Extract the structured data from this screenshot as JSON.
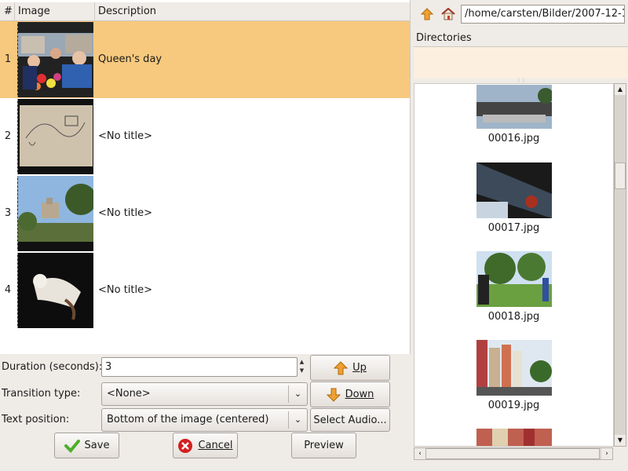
{
  "table": {
    "headers": {
      "num": "#",
      "image": "Image",
      "description": "Description"
    },
    "rows": [
      {
        "num": "1",
        "description": "Queen's day",
        "selected": true
      },
      {
        "num": "2",
        "description": "<No title>",
        "selected": false
      },
      {
        "num": "3",
        "description": "<No title>",
        "selected": false
      },
      {
        "num": "4",
        "description": "<No title>",
        "selected": false
      }
    ]
  },
  "form": {
    "duration_label": "Duration (seconds):",
    "duration_value": "3",
    "transition_label": "Transition type:",
    "transition_value": "<None>",
    "textpos_label": "Text position:",
    "textpos_value": "Bottom of the image (centered)"
  },
  "buttons": {
    "up": "Up",
    "down": "Down",
    "select_audio": "Select Audio...",
    "save": "Save",
    "cancel": "Cancel",
    "preview": "Preview"
  },
  "browser": {
    "path": "/home/carsten/Bilder/2007-12-1",
    "directories_header": "Directories",
    "files": [
      "00016.jpg",
      "00017.jpg",
      "00018.jpg",
      "00019.jpg"
    ]
  },
  "colors": {
    "selection": "#f7c97e",
    "up_arrow": "#f0a030",
    "save_check": "#4caf2a",
    "cancel_x": "#d42020"
  }
}
